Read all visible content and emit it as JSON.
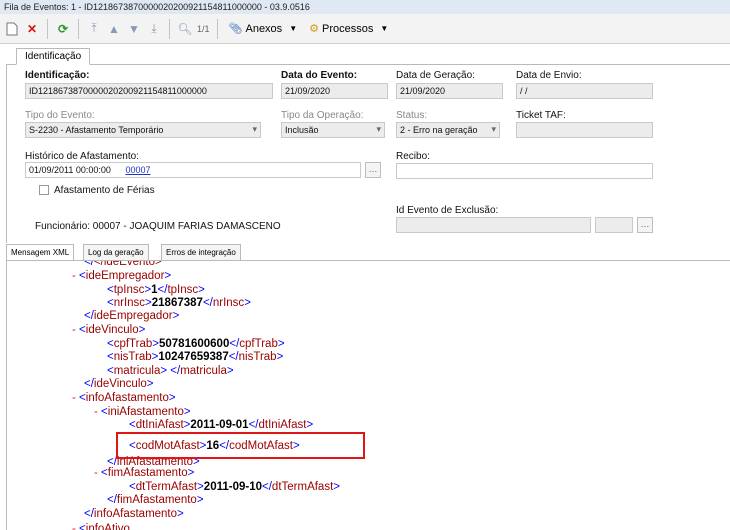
{
  "window": {
    "title": "Fila de Eventos: 1 - ID1218673870000020200921154811000000 - 03.9.0516"
  },
  "toolbar": {
    "paging": "1/1",
    "anexos_label": "Anexos",
    "processos_label": "Processos"
  },
  "top_tabs": {
    "identificacao": "Identificação"
  },
  "form": {
    "identificacao_label": "Identificação:",
    "identificacao_value": "ID1218673870000020200921154811000000",
    "data_evento_label": "Data do Evento:",
    "data_evento_value": "21/09/2020",
    "data_geracao_label": "Data de Geração:",
    "data_geracao_value": "21/09/2020",
    "data_envio_label": "Data de Envio:",
    "data_envio_value": " / /",
    "tipo_evento_label": "Tipo do Evento:",
    "tipo_evento_value": "S-2230 - Afastamento Temporário",
    "tipo_operacao_label": "Tipo da Operação:",
    "tipo_operacao_value": "Inclusão",
    "status_label": "Status:",
    "status_value": "2 - Erro na geração",
    "ticket_label": "Ticket TAF:",
    "ticket_value": "",
    "historico_label": "Histórico de Afastamento:",
    "historico_date": "01/09/2011 00:00:00",
    "historico_link": "00007",
    "recibo_label": "Recibo:",
    "recibo_value": "",
    "ferias_label": "Afastamento de Férias",
    "funcionario_text": "Funcionário: 00007 - JOAQUIM FARIAS DAMASCENO",
    "id_exclusao_label": "Id Evento de Exclusão:"
  },
  "bottom_tabs": {
    "mensagem": "Mensagem XML",
    "log": "Log da geração",
    "erros": "Erros de integração"
  },
  "xml": {
    "ideEvento_close": "</ideEvento>",
    "ideEmpregador": "ideEmpregador",
    "tpInsc": "tpInsc",
    "tpInsc_val": "1",
    "nrInsc": "nrInsc",
    "nrInsc_val": "21867387",
    "ideVinculo": "ideVinculo",
    "cpfTrab": "cpfTrab",
    "cpfTrab_val": "50781600600",
    "nisTrab": "nisTrab",
    "nisTrab_val": "10247659387",
    "matricula": "matricula",
    "infoAfastamento": "infoAfastamento",
    "iniAfastamento": "iniAfastamento",
    "dtIniAfast": "dtIniAfast",
    "dtIniAfast_val": "2011-09-01",
    "codMotAfast": "codMotAfast",
    "codMotAfast_val": "16",
    "fimAfastamento": "fimAfastamento",
    "dtTermAfast": "dtTermAfast",
    "dtTermAfast_val": "2011-09-10",
    "infoAtivo_partial": "infoAtivo"
  },
  "colors": {
    "highlight": "#e01515",
    "tag": "#990000",
    "bracket": "#0000ff",
    "minus": "#e21b1b"
  }
}
